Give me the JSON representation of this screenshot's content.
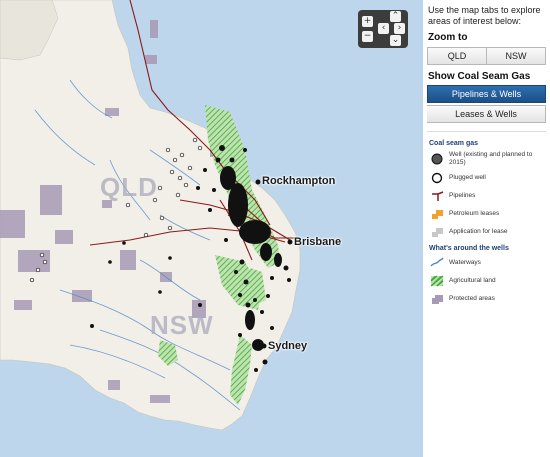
{
  "map": {
    "cities": [
      {
        "id": "rockhampton",
        "name": "Rockhampton"
      },
      {
        "id": "brisbane",
        "name": "Brisbane"
      },
      {
        "id": "sydney",
        "name": "Sydney"
      }
    ],
    "states": [
      {
        "id": "qld",
        "name": "QLD"
      },
      {
        "id": "nsw",
        "name": "NSW"
      }
    ],
    "colors": {
      "ocean": "#bdd6ec",
      "land": "#f1efe8",
      "wells": "#111111",
      "pipelines": "#8b1a1a",
      "agricultural": "#3fa535",
      "protected": "#a79ab5",
      "waterways": "#4a86c8"
    }
  },
  "zoom_control": {
    "zoom_in": "+",
    "zoom_out": "−",
    "pan_up": "⌃",
    "pan_down": "⌄",
    "pan_left": "‹",
    "pan_right": "›"
  },
  "panel": {
    "intro": "Use the map tabs to explore areas of interest below:",
    "zoom_title": "Zoom to",
    "zoom_buttons": [
      "QLD",
      "NSW"
    ],
    "show_title": "Show Coal Seam Gas",
    "show_buttons": [
      {
        "label": "Pipelines & Wells",
        "active": true
      },
      {
        "label": "Leases & Wells",
        "active": false
      }
    ],
    "legend": {
      "head1": "Coal seam gas",
      "items1": [
        {
          "label": "Well (existing and planned to 2015)",
          "icon": "well-icon"
        },
        {
          "label": "Plugged well",
          "icon": "plugged-well-icon"
        },
        {
          "label": "Pipelines",
          "icon": "pipeline-icon"
        },
        {
          "label": "Petroleum leases",
          "icon": "petroleum-lease-icon"
        },
        {
          "label": "Application for lease",
          "icon": "application-lease-icon"
        }
      ],
      "head2": "What's around the wells",
      "items2": [
        {
          "label": "Waterways",
          "icon": "waterway-icon"
        },
        {
          "label": "Agricultural land",
          "icon": "agricultural-icon"
        },
        {
          "label": "Protected areas",
          "icon": "protected-area-icon"
        }
      ]
    }
  }
}
